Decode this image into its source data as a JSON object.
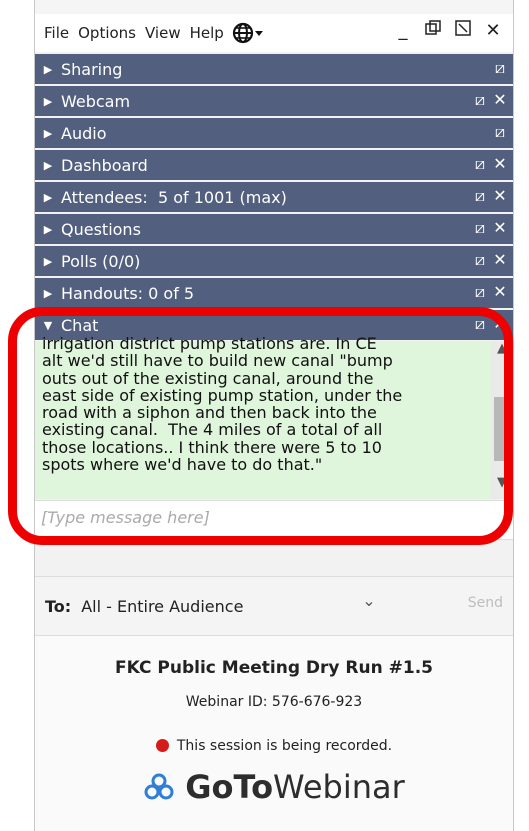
{
  "menubar": {
    "items": [
      "File",
      "Options",
      "View",
      "Help"
    ],
    "language_icon": "globe-icon"
  },
  "window_controls": [
    "minimize-icon",
    "restore-icon",
    "detach-icon",
    "close-icon"
  ],
  "sections": [
    {
      "label": "Sharing",
      "expanded": false,
      "controls": [
        "popout-icon"
      ]
    },
    {
      "label": "Webcam",
      "expanded": false,
      "controls": [
        "popout-icon",
        "close-icon"
      ]
    },
    {
      "label": "Audio",
      "expanded": false,
      "controls": [
        "popout-icon"
      ]
    },
    {
      "label": "Dashboard",
      "expanded": false,
      "controls": [
        "popout-icon",
        "close-icon"
      ]
    },
    {
      "label": "Attendees:  5 of 1001 (max)",
      "expanded": false,
      "controls": [
        "popout-icon",
        "close-icon"
      ]
    },
    {
      "label": "Questions",
      "expanded": false,
      "controls": [
        "popout-icon",
        "close-icon"
      ]
    },
    {
      "label": "Polls (0/0)",
      "expanded": false,
      "controls": [
        "popout-icon",
        "close-icon"
      ]
    },
    {
      "label": "Handouts: 0 of 5",
      "expanded": false,
      "controls": [
        "popout-icon",
        "close-icon"
      ]
    },
    {
      "label": "Chat",
      "expanded": true,
      "controls": [
        "popout-icon",
        "close-icon"
      ]
    }
  ],
  "chat": {
    "lines": [
      "irrigation district pump stations are. In CE",
      "alt we'd still have to build new canal \"bump",
      "outs out of the existing canal, around the",
      "east side of existing pump station, under the",
      "road with a siphon and then back into the",
      "existing canal.  The 4 miles of a total of all",
      "those locations.. I think there were 5 to 10",
      "spots where we'd have to do that.\""
    ],
    "input_placeholder": "[Type message here]"
  },
  "recipient": {
    "label": "To:",
    "value": "All - Entire Audience",
    "send_label": "Send"
  },
  "footer": {
    "title": "FKC Public Meeting Dry Run #1.5",
    "webinar_id": "Webinar ID: 576-676-923",
    "recording_text": "This session is being recorded.",
    "logo_bold": "GoTo",
    "logo_regular": "Webinar"
  },
  "colors": {
    "section_header": "#525f7e",
    "chat_background": "#dff5dc",
    "annotation": "#ee0000",
    "recording_dot": "#d61a1a"
  }
}
